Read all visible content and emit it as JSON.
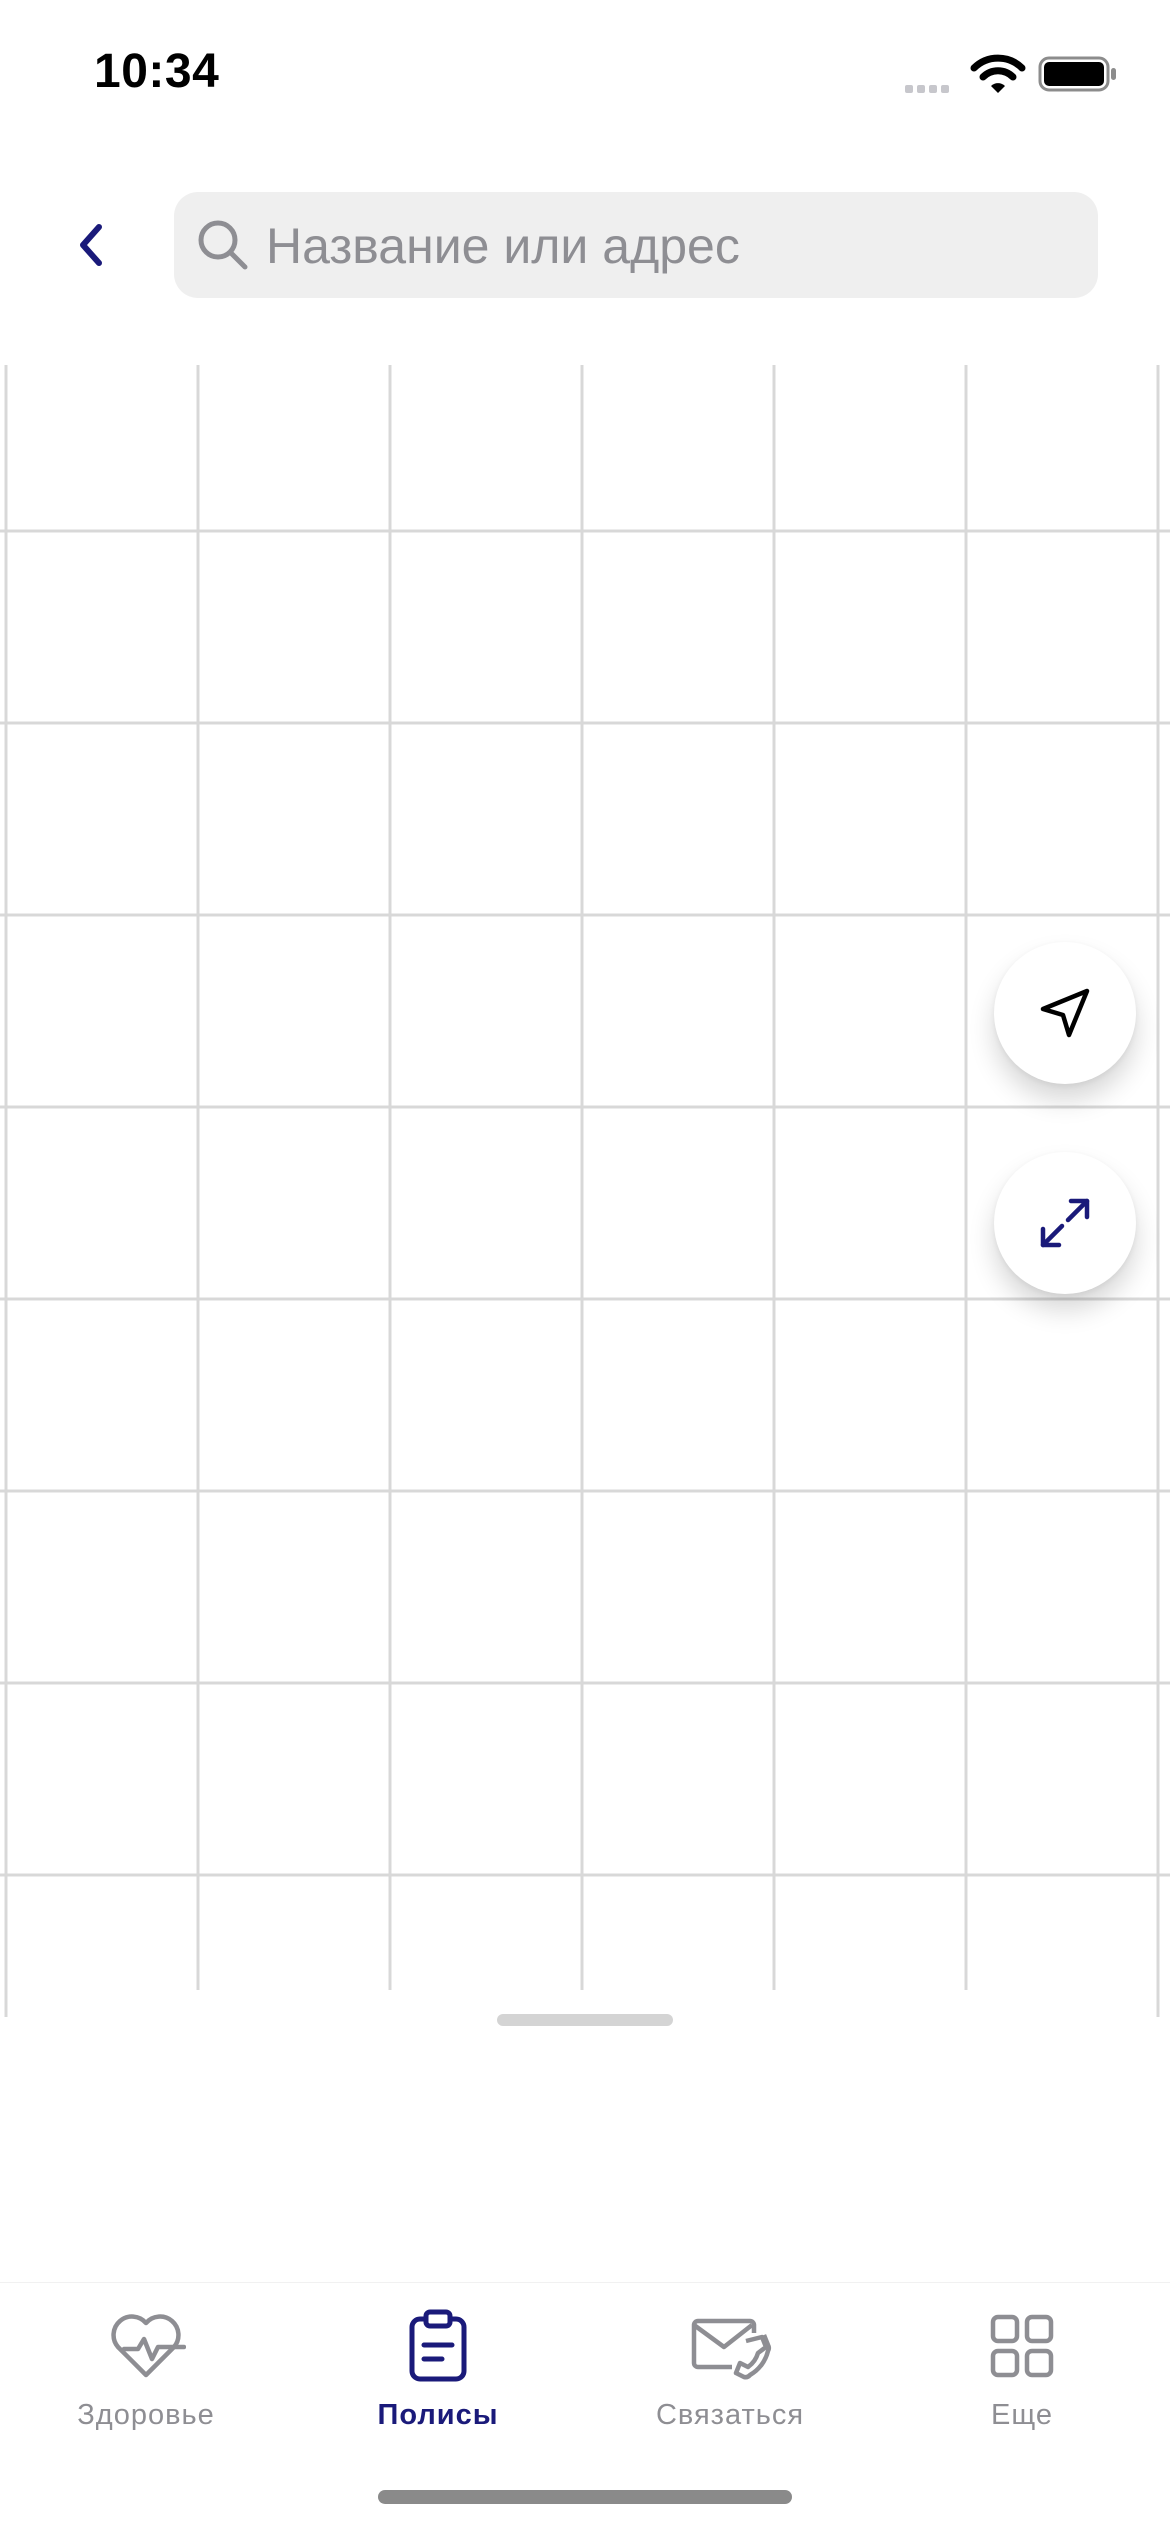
{
  "status_bar": {
    "time": "10:34",
    "wifi_icon": "wifi-icon",
    "battery_icon": "battery-full-icon"
  },
  "header": {
    "back_icon": "chevron-left-icon",
    "search": {
      "placeholder": "Название или адрес",
      "value": "",
      "icon": "search-icon"
    }
  },
  "map": {
    "locate_button_icon": "navigation-arrow-icon",
    "expand_button_icon": "expand-arrows-icon"
  },
  "tab_bar": {
    "active_tab": "Полисы",
    "tabs": [
      {
        "label": "Здоровье",
        "icon": "heart-pulse-icon"
      },
      {
        "label": "Полисы",
        "icon": "clipboard-icon"
      },
      {
        "label": "Связаться",
        "icon": "envelope-phone-icon"
      },
      {
        "label": "Еще",
        "icon": "grid-icon"
      }
    ]
  },
  "colors": {
    "accent": "#1a1a7a",
    "inactive": "#8e8e93",
    "search_bg": "#efefef",
    "map_grid_line": "#d8d8d8"
  }
}
